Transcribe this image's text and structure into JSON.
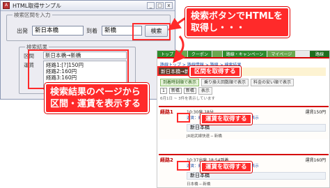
{
  "window": {
    "title": "HTML取得サンプル",
    "app_icon": "access-app-icon",
    "controls": [
      "_",
      "□",
      "x"
    ],
    "search_group": {
      "title": "検索区間を入力",
      "from_label": "出発",
      "from_value": "新日本橋",
      "to_label": "到着",
      "to_value": "新橋",
      "search_button": "検索"
    },
    "result_group": {
      "title": "検索結果",
      "route_label": "区間",
      "route_value": "新日本橋→新橋",
      "fare_label": "運賃",
      "fares": [
        "経路1:[?]150円",
        "経路2:160円",
        "経路3:160円"
      ]
    }
  },
  "web": {
    "nav_tabs": [
      "トップ",
      "",
      "",
      "",
      "",
      "クーポン",
      "",
      "",
      "",
      "",
      "路線・キャンペーン",
      "マイページ"
    ],
    "nav_right": "路線",
    "breadcrumb": "路線トップ > 路線情報 > 路線 > 検索結果",
    "route_header": "新日本橋→新橋",
    "options": [
      "到着時刻順で表示",
      "乗り換え回数順で表示",
      "料金の安い順で表示"
    ],
    "selects": [
      "1",
      "新橋",
      "新橋"
    ],
    "select_button": "表示",
    "meta": "6月1日 ~ 3件を表示しています",
    "routes": [
      {
        "name": "経路1",
        "time": "10:30発 18分",
        "pay": "運賃150円",
        "detail": "運賃：乗り換え：1回 ─ 経路の詳細を表示",
        "station": "新日本橋",
        "sub": "JR総武線快速 ─ 新橋"
      },
      {
        "name": "経路2",
        "time": "10:37出発 18:54到着",
        "pay": "運賃160円",
        "detail": "運賃：乗り換え：1回 ─ 経路の詳細を表示",
        "station": "新日本橋",
        "sub": "日本橋 ─ 新橋"
      }
    ]
  },
  "annotations": {
    "top": "検索ボタンでHTMLを\n取得し・・・",
    "middle": "検索結果のページから\n区間・運賃を表示する",
    "route_tag": "区間を取得する",
    "fare_tag_1": "運賃を取得する",
    "fare_tag_2": "運賃を取得する"
  },
  "colors": {
    "accent_red": "#ff2a2a",
    "nav_green": "#2e8b2e",
    "window_bg": "#ececf2"
  }
}
